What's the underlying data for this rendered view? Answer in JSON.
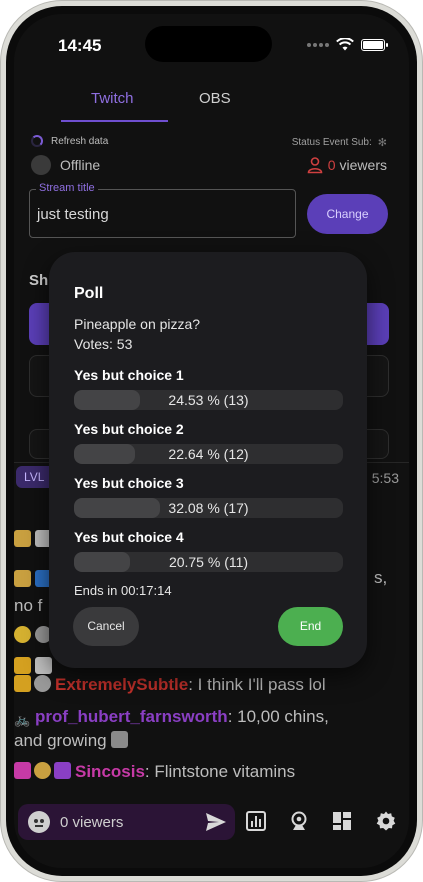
{
  "status_bar": {
    "time": "14:45"
  },
  "tabs": [
    {
      "label": "Twitch"
    },
    {
      "label": "OBS"
    }
  ],
  "stream": {
    "refresh_label": "Refresh data",
    "offline_label": "Offline",
    "status_event_sub_label": "Status Event Sub:",
    "viewers_count": "0",
    "viewers_label": "viewers",
    "title_label": "Stream title",
    "title_value": "just testing",
    "change_label": "Change"
  },
  "background": {
    "shortcuts_heading_fragment": "Sh",
    "lvl_badge": "LVL",
    "chat_time_fragment": "5:53",
    "frag_s": "s,",
    "frag_no_f": "no f"
  },
  "chat": [
    {
      "username": "ExtremelySubtle",
      "user_color": "#c0302a",
      "message": ": I think I'll pass lol"
    },
    {
      "username": "prof_hubert_farnsworth",
      "user_color": "#8a3fc4",
      "message": ": 10,00 chins,",
      "continuation": "and growing"
    },
    {
      "username": "Sincosis",
      "user_color": "#c63aa6",
      "message": ": Flintstone vitamins"
    }
  ],
  "bottom_bar": {
    "viewers_placeholder": "0 viewers"
  },
  "poll": {
    "title": "Poll",
    "question": "Pineapple on pizza?",
    "votes_label": "Votes: 53",
    "choices": [
      {
        "label": "Yes but choice 1",
        "text": "24.53 % (13)",
        "fraction": 0.2453
      },
      {
        "label": "Yes but choice 2",
        "text": "22.64 % (12)",
        "fraction": 0.2264
      },
      {
        "label": "Yes but choice 3",
        "text": "32.08 % (17)",
        "fraction": 0.3208
      },
      {
        "label": "Yes but choice 4",
        "text": "20.75 % (11)",
        "fraction": 0.2075
      }
    ],
    "ends_label": "Ends in 00:17:14",
    "cancel_label": "Cancel",
    "end_label": "End"
  }
}
